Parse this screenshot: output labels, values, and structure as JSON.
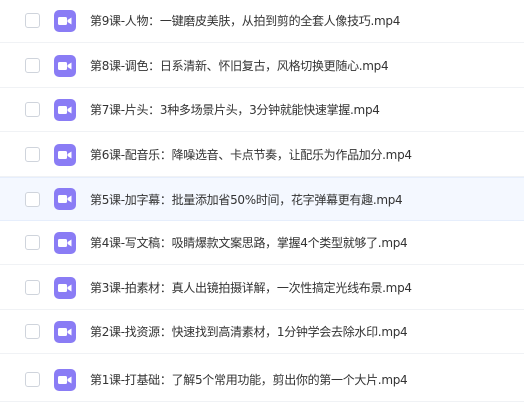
{
  "files": [
    {
      "name": "第9课-人物：一键磨皮美肤，从拍到剪的全套人像技巧.mp4",
      "icon": "video-file-icon",
      "hover": false
    },
    {
      "name": "第8课-调色：日系清新、怀旧复古，风格切换更随心.mp4",
      "icon": "video-file-icon",
      "hover": false
    },
    {
      "name": "第7课-片头：3种多场景片头，3分钟就能快速掌握.mp4",
      "icon": "video-file-icon",
      "hover": false
    },
    {
      "name": "第6课-配音乐：降噪选音、卡点节奏，让配乐为作品加分.mp4",
      "icon": "video-file-icon",
      "hover": false
    },
    {
      "name": "第5课-加字幕：批量添加省50%时间，花字弹幕更有趣.mp4",
      "icon": "video-file-icon",
      "hover": true
    },
    {
      "name": "第4课-写文稿：吸睛爆款文案思路，掌握4个类型就够了.mp4",
      "icon": "video-file-icon",
      "hover": false
    },
    {
      "name": "第3课-拍素材：真人出镜拍摄详解，一次性搞定光线布景.mp4",
      "icon": "video-file-icon",
      "hover": false
    },
    {
      "name": "第2课-找资源：快速找到高清素材，1分钟学会去除水印.mp4",
      "icon": "video-file-icon",
      "hover": false
    },
    {
      "name": "第1课-打基础：了解5个常用功能，剪出你的第一个大片.mp4",
      "icon": "video-file-icon",
      "hover": false
    }
  ],
  "colors": {
    "icon_bg": "#8a7cf5",
    "hover_row_bg": "#f4f8ff",
    "text": "#333333"
  }
}
